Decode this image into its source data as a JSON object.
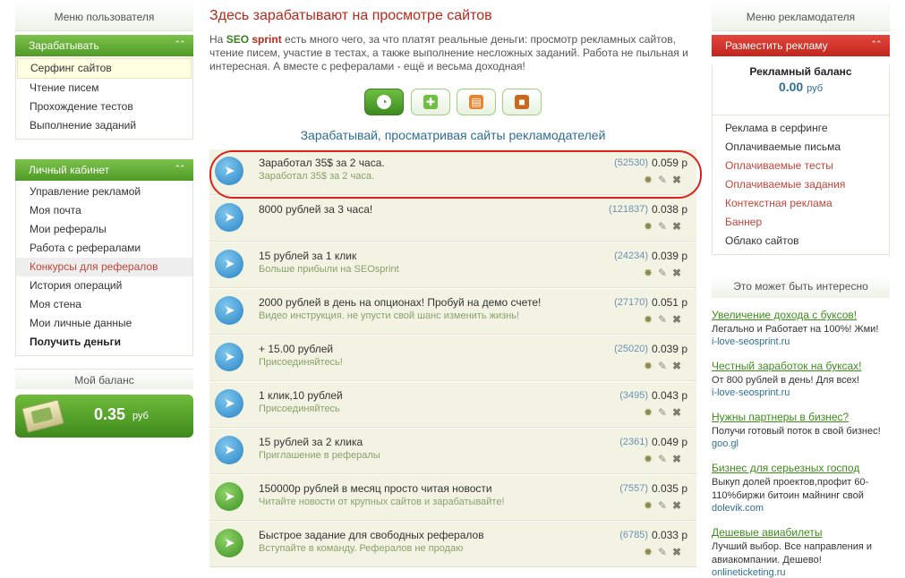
{
  "left": {
    "user_menu_title": "Меню пользователя",
    "earn_bar": "Зарабатывать",
    "earn_items": [
      {
        "label": "Серфинг сайтов"
      },
      {
        "label": "Чтение писем"
      },
      {
        "label": "Прохождение тестов"
      },
      {
        "label": "Выполнение заданий"
      }
    ],
    "cabinet_bar": "Личный кабинет",
    "cabinet_items": [
      {
        "label": "Управление рекламой"
      },
      {
        "label": "Моя почта"
      },
      {
        "label": "Мои рефералы"
      },
      {
        "label": "Работа с рефералами"
      },
      {
        "label": "Конкурсы для рефералов"
      },
      {
        "label": "История операций"
      },
      {
        "label": "Моя стена"
      },
      {
        "label": "Мои личные данные"
      },
      {
        "label": "Получить деньги"
      }
    ],
    "balance_title": "Мой баланс",
    "balance_value": "0.35",
    "balance_currency": "руб"
  },
  "main": {
    "title": "Здесь зарабатывают на просмотре сайтов",
    "intro_prefix": "На ",
    "intro_brand_a": "SEO",
    "intro_brand_b": " sprint",
    "intro_rest": " есть много чего, за что платят реальные деньги: просмотр рекламных сайтов, чтение писем, участие в тестах, а также выполнение несложных заданий. Работа не пыльная и интересная. А вместе с рефералами - ещё и весьма доходная!",
    "categories": [
      {
        "icon": "surf-icon"
      },
      {
        "icon": "mail-icon"
      },
      {
        "icon": "test-icon"
      },
      {
        "icon": "task-icon"
      }
    ],
    "subtitle": "Зарабатывай, просматривая сайты рекламодателей",
    "ads": [
      {
        "title": "Заработал 35$ за 2 часа.",
        "desc": "Заработал 35$ за 2 часа.",
        "count": "(52530)",
        "price": "0.059 р",
        "color": "blue"
      },
      {
        "title": "8000 рублей за 3 часа!",
        "desc": "",
        "count": "(121837)",
        "price": "0.038 р",
        "color": "blue"
      },
      {
        "title": "15 рублей за 1 клик",
        "desc": "Больше прибыли на SEOsprint",
        "count": "(24234)",
        "price": "0.039 р",
        "color": "blue"
      },
      {
        "title": "2000 рублей в день на опционах! Пробуй на демо счете!",
        "desc": "Видео инструкция. не упусти свой шанс изменить жизнь!",
        "count": "(27170)",
        "price": "0.051 р",
        "color": "blue"
      },
      {
        "title": "+ 15.00 рублей",
        "desc": "Присоединяйтесь!",
        "count": "(25020)",
        "price": "0.039 р",
        "color": "blue"
      },
      {
        "title": "1 клик,10 рублей",
        "desc": "Присоединяйтесь",
        "count": "(3495)",
        "price": "0.043 р",
        "color": "blue"
      },
      {
        "title": "15 рублей за 2 клика",
        "desc": "Приглашение в рефералы",
        "count": "(2361)",
        "price": "0.049 р",
        "color": "blue"
      },
      {
        "title": "150000р рублей в месяц просто читая новости",
        "desc": "Читайте новости от крупных сайтов и зарабатывайте!",
        "count": "(7557)",
        "price": "0.035 р",
        "color": "green"
      },
      {
        "title": "Быстрое задание для свободных рефералов",
        "desc": "Вступайте в команду. Рефералов не продаю",
        "count": "(6785)",
        "price": "0.033 р",
        "color": "green"
      }
    ]
  },
  "right": {
    "adv_menu_title": "Меню рекламодателя",
    "place_bar": "Разместить рекламу",
    "ad_balance_title": "Рекламный баланс",
    "ad_balance_value": "0.00",
    "ad_balance_currency": "руб",
    "adv_items": [
      {
        "label": "Реклама в серфинге",
        "red": false
      },
      {
        "label": "Оплачиваемые письма",
        "red": false
      },
      {
        "label": "Оплачиваемые тесты",
        "red": true
      },
      {
        "label": "Оплачиваемые задания",
        "red": true
      },
      {
        "label": "Контекстная реклама",
        "red": true
      },
      {
        "label": "Баннер",
        "red": true
      },
      {
        "label": "Облако сайтов",
        "red": false
      }
    ],
    "interest_title": "Это может быть интересно",
    "teasers": [
      {
        "head": "Увеличение дохода с буксов!",
        "desc": "Легально и Работает на 100%! Жми!",
        "url": "i-love-seosprint.ru"
      },
      {
        "head": "Честный заработок на буксах!",
        "desc": "От 800 рублей в день! Для всех!",
        "url": "i-love-seosprint.ru"
      },
      {
        "head": "Нужны партнеры в бизнес?",
        "desc": "Получи готовый поток в свой бизнес!",
        "url": "goo.gl"
      },
      {
        "head": "Бизнес для серьезных господ",
        "desc": "Выкуп долей проектов,профит 60-110%биржи битоин майнинг свой",
        "url": "dolevik.com"
      },
      {
        "head": "Дешевые авиабилеты",
        "desc": "Лучший выбор. Все направления и авиакомпании. Дешево!",
        "url": "onlineticketing.ru"
      }
    ]
  },
  "colors": {
    "accent_green": "#4f9a26",
    "accent_red": "#c2261d",
    "highlight_ring": "#e0201b"
  }
}
